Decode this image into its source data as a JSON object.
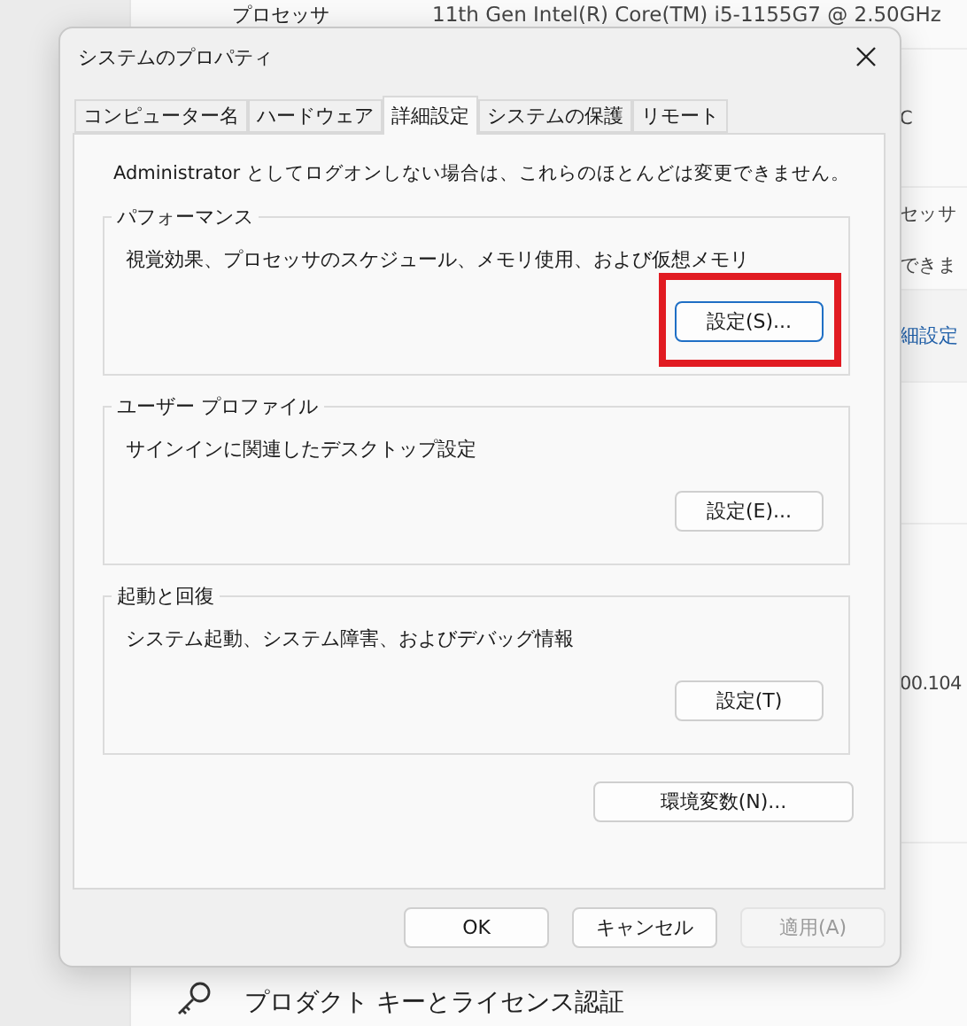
{
  "background": {
    "processor_label": "プロセッサ",
    "processor_value": "11th Gen Intel(R) Core(TM) i5-1155G7 @ 2.50GHz",
    "fragment_1": "C",
    "fragment_2": "セッサ",
    "fragment_3": "できま",
    "link_fragment": "細設定",
    "fragment_4": "00.104",
    "product_key_title": "プロダクト キーとライセンス認証"
  },
  "dialog": {
    "title": "システムのプロパティ",
    "tabs": [
      {
        "label": "コンピューター名",
        "selected": false
      },
      {
        "label": "ハードウェア",
        "selected": false
      },
      {
        "label": "詳細設定",
        "selected": true
      },
      {
        "label": "システムの保護",
        "selected": false
      },
      {
        "label": "リモート",
        "selected": false
      }
    ],
    "notice": "Administrator としてログオンしない場合は、これらのほとんどは変更できません。",
    "groups": [
      {
        "title": "パフォーマンス",
        "description": "視覚効果、プロセッサのスケジュール、メモリ使用、および仮想メモリ",
        "button": "設定(S)...",
        "highlighted": true,
        "focused": true
      },
      {
        "title": "ユーザー プロファイル",
        "description": "サインインに関連したデスクトップ設定",
        "button": "設定(E)...",
        "highlighted": false,
        "focused": false
      },
      {
        "title": "起動と回復",
        "description": "システム起動、システム障害、およびデバッグ情報",
        "button": "設定(T)",
        "highlighted": false,
        "focused": false
      }
    ],
    "env_button": "環境変数(N)...",
    "footer_buttons": [
      {
        "label": "OK",
        "disabled": false
      },
      {
        "label": "キャンセル",
        "disabled": false
      },
      {
        "label": "適用(A)",
        "disabled": true
      }
    ]
  }
}
